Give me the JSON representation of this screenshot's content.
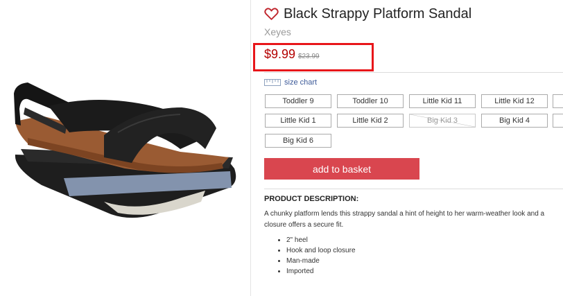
{
  "product": {
    "title": "Black Strappy Platform Sandal",
    "brand": "Xeyes",
    "price_current": "$9.99",
    "price_original": "$23.99"
  },
  "size_chart": {
    "label": "size chart"
  },
  "sizes": [
    {
      "label": "Toddler 9",
      "available": true
    },
    {
      "label": "Toddler 10",
      "available": true
    },
    {
      "label": "Little Kid 11",
      "available": true
    },
    {
      "label": "Little Kid 12",
      "available": true
    },
    {
      "label": "Little Kid 1",
      "available": true
    },
    {
      "label": "Little Kid 2",
      "available": true
    },
    {
      "label": "Big Kid 3",
      "available": false
    },
    {
      "label": "Big Kid 4",
      "available": true
    },
    {
      "label": "Big Kid 6",
      "available": true
    }
  ],
  "cart": {
    "add_label": "add to basket"
  },
  "description": {
    "heading": "PRODUCT DESCRIPTION:",
    "text_line1": "A chunky platform lends this strappy sandal a hint of height to her warm-weather look and a",
    "text_line2": "closure offers a secure fit.",
    "features": [
      "2\" heel",
      "Hook and loop closure",
      "Man-made",
      "Imported"
    ]
  },
  "colors": {
    "price": "#b40000",
    "highlight_box": "#e8161a",
    "basket_button": "#d9464f",
    "link": "#3b5998"
  },
  "icons": [
    "heart-outline-icon",
    "ruler-icon"
  ]
}
